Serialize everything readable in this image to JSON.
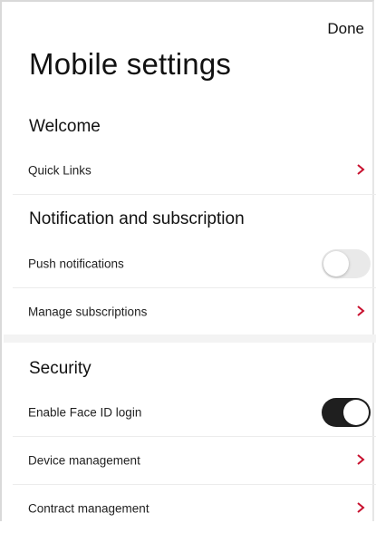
{
  "header": {
    "done_label": "Done",
    "title": "Mobile settings"
  },
  "sections": {
    "welcome": {
      "heading": "Welcome",
      "items": [
        {
          "label": "Quick Links",
          "control": "chevron"
        }
      ]
    },
    "notification": {
      "heading": "Notification and subscription",
      "items": [
        {
          "label": "Push notifications",
          "control": "toggle",
          "toggle_on": false
        },
        {
          "label": "Manage subscriptions",
          "control": "chevron"
        }
      ]
    },
    "security": {
      "heading": "Security",
      "items": [
        {
          "label": "Enable Face ID login",
          "control": "toggle",
          "toggle_on": true
        },
        {
          "label": "Device management",
          "control": "chevron"
        },
        {
          "label": "Contract management",
          "control": "chevron"
        }
      ]
    }
  },
  "colors": {
    "chevron": "#c8102e",
    "toggle_on": "#1f1f1f",
    "toggle_off": "#e9e9e9",
    "divider": "#ececec",
    "section_band": "#f3f3f3"
  }
}
